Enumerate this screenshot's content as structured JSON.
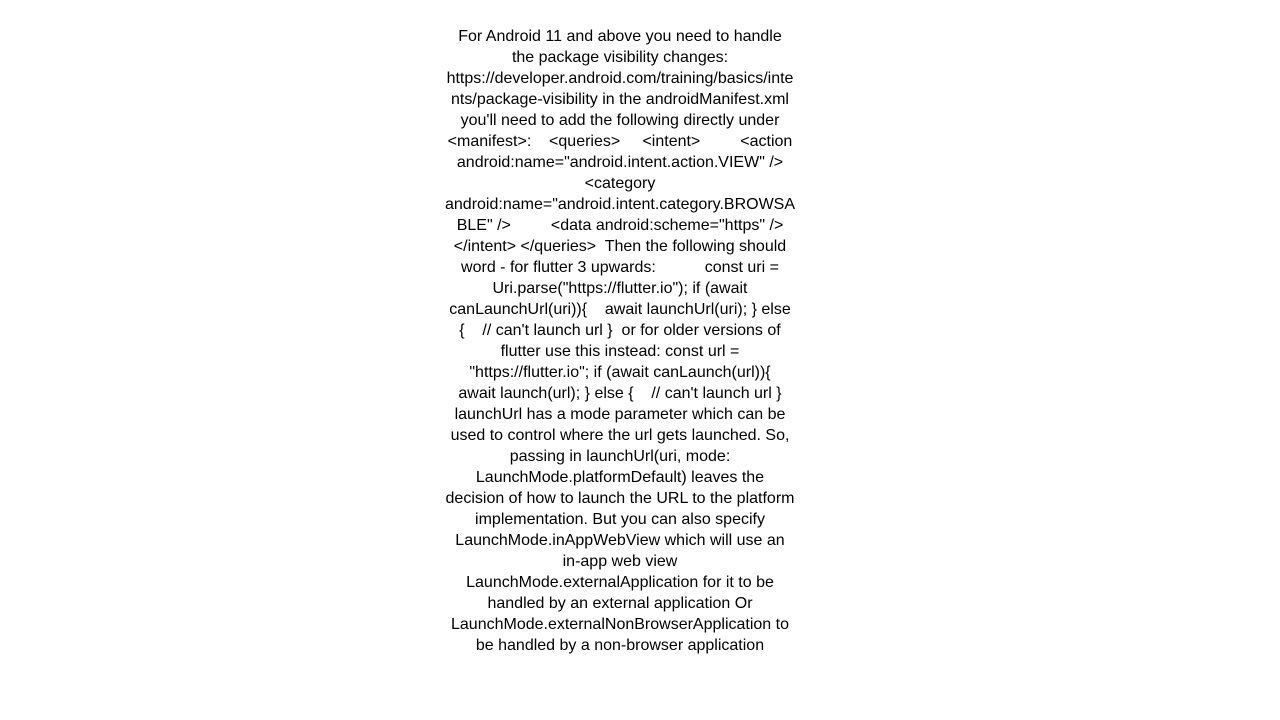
{
  "page": {
    "background_color": "#ffffff",
    "text_color": "#000000",
    "alignment": "center"
  },
  "answer": {
    "body": "For Android 11 and above you need to handle the package visibility changes: https://developer.android.com/training/basics/intents/package-visibility in the androidManifest.xml you'll need to add the following directly under <manifest>:    <queries>     <intent>         <action android:name=\"android.intent.action.VIEW\" />         <category android:name=\"android.intent.category.BROWSABLE\" />         <data android:scheme=\"https\" />     </intent> </queries>  Then the following should word - for flutter 3 upwards:           const uri = Uri.parse(\"https://flutter.io\"); if (await canLaunchUrl(uri)){    await launchUrl(uri); } else {    // can't launch url }  or for older versions of flutter use this instead: const url = \"https://flutter.io\"; if (await canLaunch(url)){    await launch(url); } else {    // can't launch url }  launchUrl has a mode parameter which can be used to control where the url gets launched. So, passing in launchUrl(uri, mode: LaunchMode.platformDefault) leaves the decision of how to launch the URL to the platform implementation. But you can also specify LaunchMode.inAppWebView which will use an in-app web view LaunchMode.externalApplication for it to be handled by an external application Or LaunchMode.externalNonBrowserApplication to be handled by a non-browser application"
  }
}
